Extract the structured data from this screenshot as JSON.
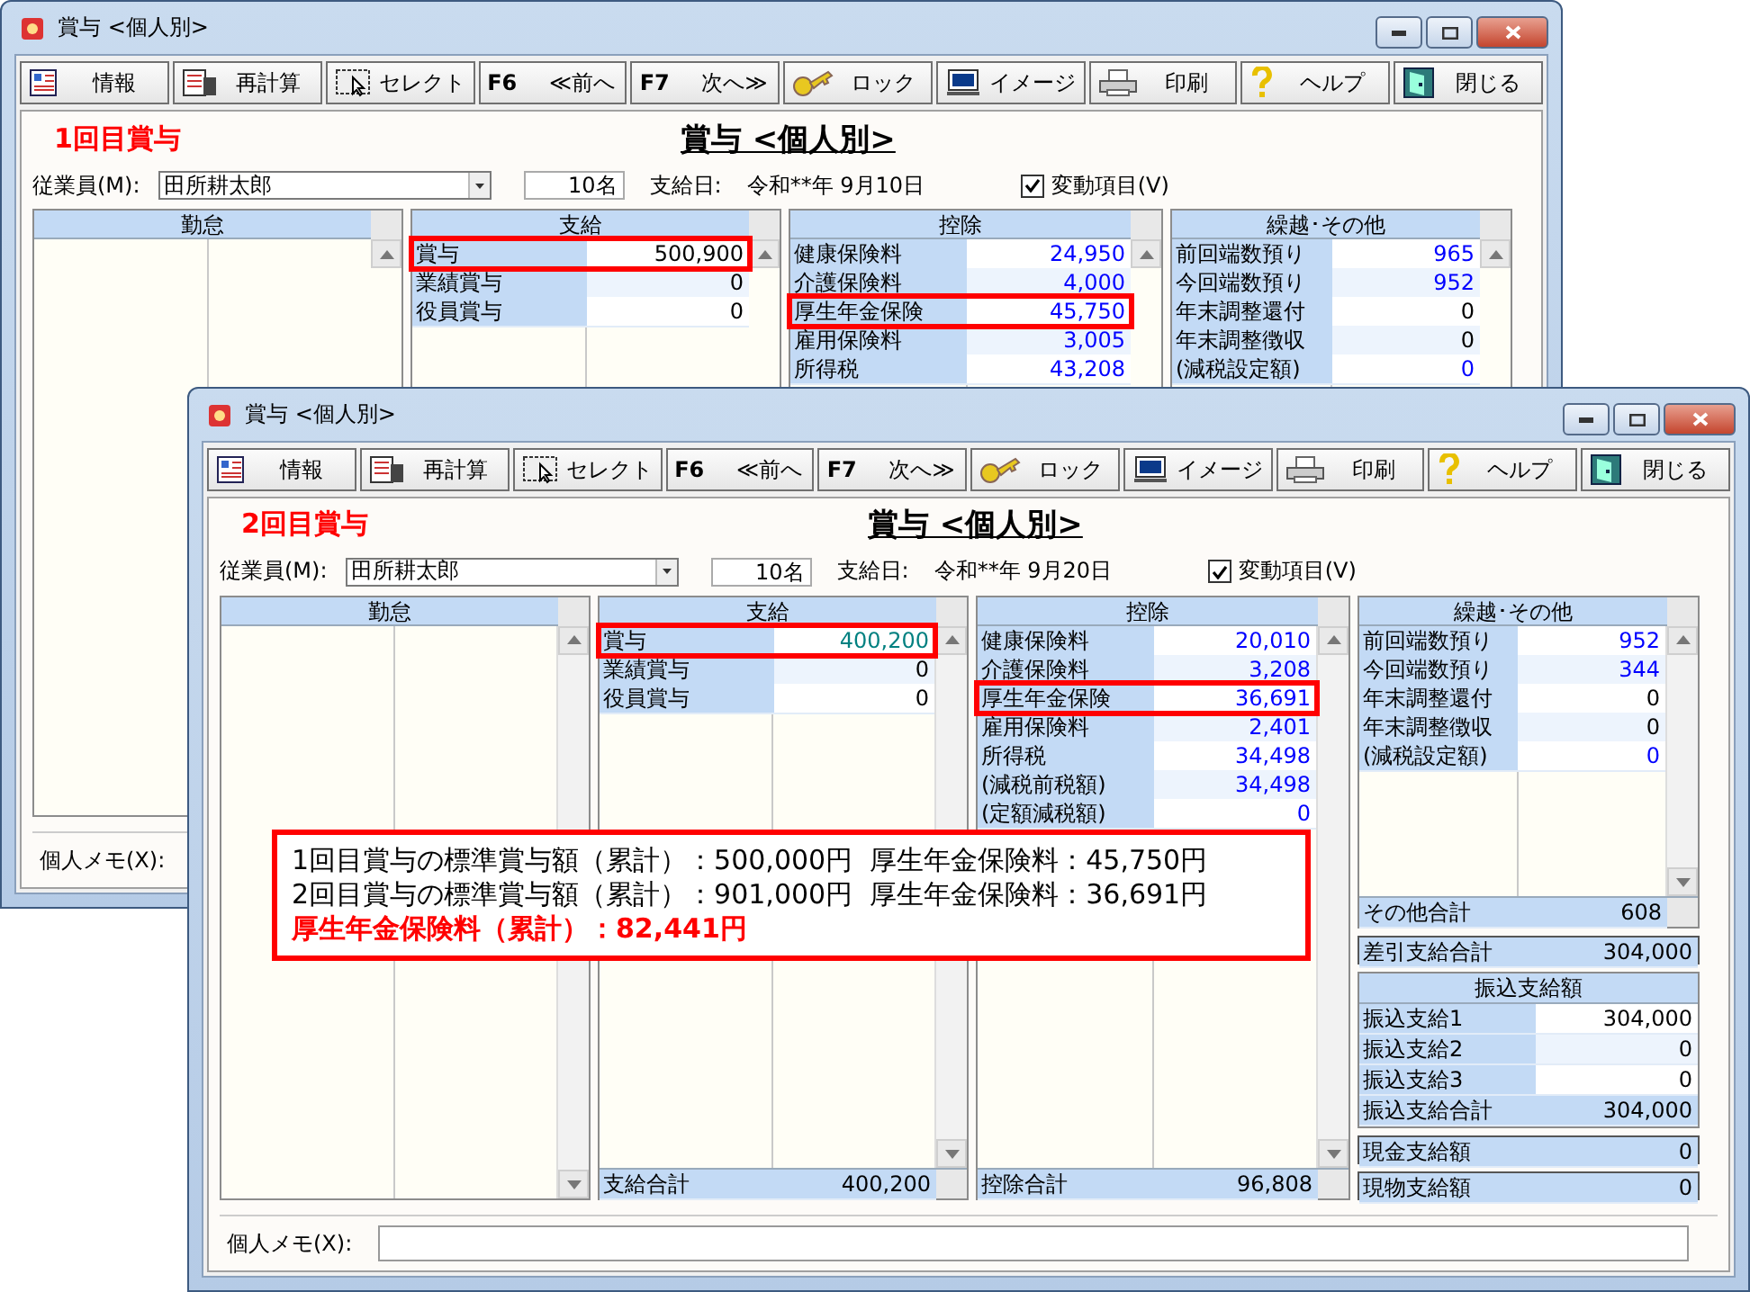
{
  "windows": [
    {
      "title": "賞与 <個人別>",
      "toolbar": [
        {
          "label": "情報"
        },
        {
          "label": "再計算"
        },
        {
          "label": "セレクト"
        },
        {
          "key": "F6",
          "label": "≪前へ"
        },
        {
          "key": "F7",
          "label": "次へ≫"
        },
        {
          "label": "ロック"
        },
        {
          "label": "イメージ"
        },
        {
          "label": "印刷"
        },
        {
          "label": "ヘルプ"
        },
        {
          "label": "閉じる"
        }
      ],
      "round_label": "1回目賞与",
      "heading": "賞与 <個人別>",
      "employee": {
        "label": "従業員(M):",
        "value": "田所耕太郎",
        "count": "10名"
      },
      "pay_date": {
        "label": "支給日:",
        "value": "令和**年 9月10日"
      },
      "variable_items": {
        "label": "変動項目(V)",
        "checked": true
      },
      "panels": [
        {
          "title": "勤怠"
        },
        {
          "title": "支給",
          "rows": [
            {
              "label": "賞与",
              "value": "500,900",
              "color": "#000000",
              "highlighted": true
            },
            {
              "label": "業績賞与",
              "value": "0",
              "color": "#000000",
              "highlighted": false
            },
            {
              "label": "役員賞与",
              "value": "0",
              "color": "#000000",
              "highlighted": false
            }
          ]
        },
        {
          "title": "控除",
          "rows": [
            {
              "label": "健康保険料",
              "value": "24,950",
              "color": "#0000ff",
              "highlighted": false
            },
            {
              "label": "介護保険料",
              "value": "4,000",
              "color": "#0000ff",
              "highlighted": false
            },
            {
              "label": "厚生年金保険",
              "value": "45,750",
              "color": "#0000ff",
              "highlighted": true
            },
            {
              "label": "雇用保険料",
              "value": "3,005",
              "color": "#0000ff",
              "highlighted": false
            },
            {
              "label": "所得税",
              "value": "43,208",
              "color": "#0000ff",
              "highlighted": false
            }
          ]
        },
        {
          "title": "繰越･その他",
          "rows": [
            {
              "label": "前回端数預り",
              "value": "965",
              "color": "#0000ff",
              "highlighted": false
            },
            {
              "label": "今回端数預り",
              "value": "952",
              "color": "#0000ff",
              "highlighted": false
            },
            {
              "label": "年末調整還付",
              "value": "0",
              "color": "#000000",
              "highlighted": false
            },
            {
              "label": "年末調整徴収",
              "value": "0",
              "color": "#000000",
              "highlighted": false
            },
            {
              "label": "(減税設定額)",
              "value": "0",
              "color": "#0000ff",
              "highlighted": false
            }
          ]
        }
      ],
      "memo": {
        "label": "個人メモ(X):"
      }
    },
    {
      "title": "賞与 <個人別>",
      "toolbar": [
        {
          "label": "情報"
        },
        {
          "label": "再計算"
        },
        {
          "label": "セレクト"
        },
        {
          "key": "F6",
          "label": "≪前へ"
        },
        {
          "key": "F7",
          "label": "次へ≫"
        },
        {
          "label": "ロック"
        },
        {
          "label": "イメージ"
        },
        {
          "label": "印刷"
        },
        {
          "label": "ヘルプ"
        },
        {
          "label": "閉じる"
        }
      ],
      "round_label": "2回目賞与",
      "heading": "賞与 <個人別>",
      "employee": {
        "label": "従業員(M):",
        "value": "田所耕太郎",
        "count": "10名"
      },
      "pay_date": {
        "label": "支給日:",
        "value": "令和**年 9月20日"
      },
      "variable_items": {
        "label": "変動項目(V)",
        "checked": true
      },
      "panels": [
        {
          "title": "勤怠"
        },
        {
          "title": "支給",
          "rows": [
            {
              "label": "賞与",
              "value": "400,200",
              "color": "#008080",
              "highlighted": true
            },
            {
              "label": "業績賞与",
              "value": "0",
              "color": "#000000",
              "highlighted": false
            },
            {
              "label": "役員賞与",
              "value": "0",
              "color": "#000000",
              "highlighted": false
            }
          ],
          "total": {
            "label": "支給合計",
            "value": "400,200"
          }
        },
        {
          "title": "控除",
          "rows": [
            {
              "label": "健康保険料",
              "value": "20,010",
              "color": "#0000ff",
              "highlighted": false
            },
            {
              "label": "介護保険料",
              "value": "3,208",
              "color": "#0000ff",
              "highlighted": false
            },
            {
              "label": "厚生年金保険",
              "value": "36,691",
              "color": "#0000ff",
              "highlighted": true
            },
            {
              "label": "雇用保険料",
              "value": "2,401",
              "color": "#0000ff",
              "highlighted": false
            },
            {
              "label": "所得税",
              "value": "34,498",
              "color": "#0000ff",
              "highlighted": false
            },
            {
              "label": "(減税前税額)",
              "value": "34,498",
              "color": "#0000ff",
              "highlighted": false
            },
            {
              "label": "(定額減税額)",
              "value": "0",
              "color": "#0000ff",
              "highlighted": false
            }
          ],
          "total": {
            "label": "控除合計",
            "value": "96,808"
          }
        },
        {
          "title": "繰越･その他",
          "rows": [
            {
              "label": "前回端数預り",
              "value": "952",
              "color": "#0000ff",
              "highlighted": false
            },
            {
              "label": "今回端数預り",
              "value": "344",
              "color": "#0000ff",
              "highlighted": false
            },
            {
              "label": "年末調整還付",
              "value": "0",
              "color": "#000000",
              "highlighted": false
            },
            {
              "label": "年末調整徴収",
              "value": "0",
              "color": "#000000",
              "highlighted": false
            },
            {
              "label": "(減税設定額)",
              "value": "0",
              "color": "#0000ff",
              "highlighted": false
            }
          ],
          "total": {
            "label": "その他合計",
            "value": "608"
          }
        }
      ],
      "side_boxes": [
        {
          "kind": "total",
          "label": "差引支給合計",
          "value": "304,000"
        },
        {
          "kind": "panel",
          "title": "振込支給額",
          "rows": [
            {
              "kind": "item",
              "label": "振込支給1",
              "value": "304,000"
            },
            {
              "kind": "item",
              "label": "振込支給2",
              "value": "0"
            },
            {
              "kind": "item",
              "label": "振込支給3",
              "value": "0"
            },
            {
              "kind": "sum",
              "label": "振込支給合計",
              "value": "304,000"
            }
          ]
        },
        {
          "kind": "total",
          "label": "現金支給額",
          "value": "0"
        },
        {
          "kind": "total",
          "label": "現物支給額",
          "value": "0"
        }
      ],
      "memo": {
        "label": "個人メモ(X):"
      },
      "note": {
        "lines": [
          {
            "text": "1回目賞与の標準賞与額（累計）：500,000円  厚生年金保険料：45,750円",
            "emphasis": false
          },
          {
            "text": "2回目賞与の標準賞与額（累計）：901,000円  厚生年金保険料：36,691円",
            "emphasis": false
          },
          {
            "text": "厚生年金保険料（累計）：82,441円",
            "emphasis": true
          }
        ]
      }
    }
  ]
}
